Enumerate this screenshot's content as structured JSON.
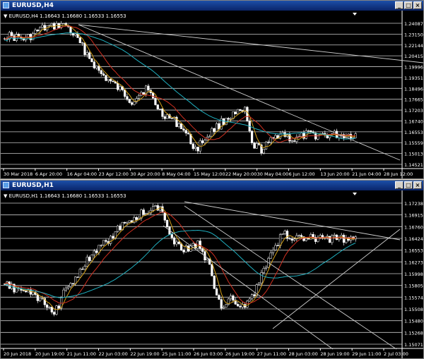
{
  "windows": [
    {
      "title": "EURUSD,H4",
      "info": "EURUSD,H4  1.16643 1.16680 1.16533 1.16553",
      "price_labels": [
        "1.24087",
        "1.23150",
        "1.22144",
        "1.20415",
        "1.19996",
        "1.19351",
        "1.18496",
        "1.17665",
        "1.17203",
        "1.16740",
        "1.16553",
        "1.15559",
        "1.15013",
        "1.14521"
      ],
      "time_labels": [
        "30 Mar 2018",
        "6 Apr 20:00",
        "16 Apr 04:00",
        "23 Apr 12:00",
        "30 Apr 20:00",
        "8 May 04:00",
        "15 May 12:00",
        "22 May 20:00",
        "30 May 04:00",
        "6 Jun 12:00",
        "13 Jun 20:00",
        "21 Jun 04:00",
        "28 Jun 12:00"
      ]
    },
    {
      "title": "EURUSD,H1",
      "info": "EURUSD,H1  1.16643 1.16680 1.16533 1.16553",
      "price_labels": [
        "1.17238",
        "1.16915",
        "1.16760",
        "1.16424",
        "1.16553",
        "1.16273",
        "1.15998",
        "1.15805",
        "1.15574",
        "1.15508",
        "1.15480",
        "1.15268",
        "1.15071"
      ],
      "time_labels": [
        "20 Jun 2018",
        "20 Jun 19:00",
        "21 Jun 11:00",
        "22 Jun 03:00",
        "22 Jun 19:00",
        "25 Jun 11:00",
        "26 Jun 03:00",
        "26 Jun 19:00",
        "27 Jun 11:00",
        "28 Jun 03:00",
        "28 Jun 19:00",
        "29 Jun 11:00",
        "2 Jul 03:00"
      ]
    }
  ],
  "colors": {
    "bull": "#ffffff",
    "bear": "#ffffff",
    "ma_fast": "#d4a017",
    "ma_mid": "#d03020",
    "ma_slow": "#20b0c0",
    "line": "#cfcfcf"
  }
}
